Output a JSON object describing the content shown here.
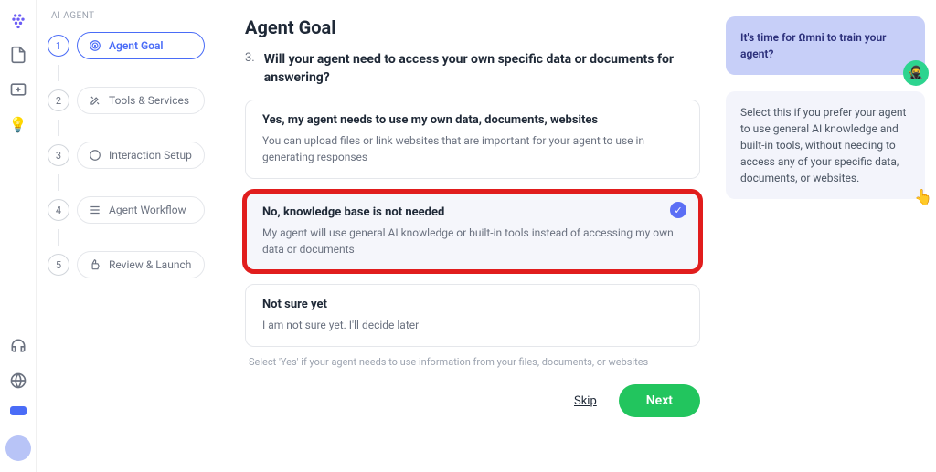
{
  "app": {
    "sidebar_title": "AI AGENT"
  },
  "sidebar": {
    "steps": [
      {
        "num": "1",
        "label": "Agent Goal"
      },
      {
        "num": "2",
        "label": "Tools & Services"
      },
      {
        "num": "3",
        "label": "Interaction Setup"
      },
      {
        "num": "4",
        "label": "Agent Workflow"
      },
      {
        "num": "5",
        "label": "Review & Launch"
      }
    ]
  },
  "main": {
    "title": "Agent Goal",
    "question_num": "3.",
    "question": "Will your agent need to access your own specific data or documents for answering?",
    "options": [
      {
        "title": "Yes, my agent needs to use my own data, documents, websites",
        "desc": "You can upload files or link websites that are important for your agent to use in generating responses"
      },
      {
        "title": "No, knowledge base is not needed",
        "desc": "My agent will use general AI knowledge or built-in tools instead of accessing my own data or documents"
      },
      {
        "title": "Not sure yet",
        "desc": "I am not sure yet. I'll decide later"
      }
    ],
    "hint": "Select 'Yes' if your agent needs to use information from your files, documents, or websites",
    "skip_label": "Skip",
    "next_label": "Next"
  },
  "tips": {
    "train": "It's time for Ωmni to train your agent?",
    "explain": "Select this if you prefer your agent to use general AI knowledge and built-in tools, without needing to access any of your specific data, documents, or websites."
  }
}
